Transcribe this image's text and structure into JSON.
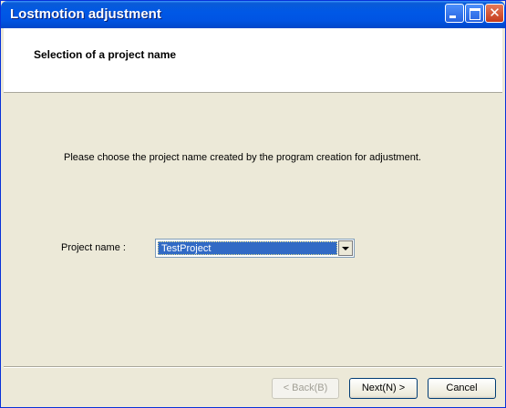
{
  "window": {
    "title": "Lostmotion adjustment",
    "close_glyph": "✕"
  },
  "header": {
    "title": "Selection of a project name"
  },
  "main": {
    "instruction": "Please choose the project name created by the program creation for adjustment.",
    "project_label": "Project name :",
    "project_value": "TestProject"
  },
  "buttons": {
    "back": "< Back(B)",
    "next": "Next(N) >",
    "cancel": "Cancel"
  }
}
